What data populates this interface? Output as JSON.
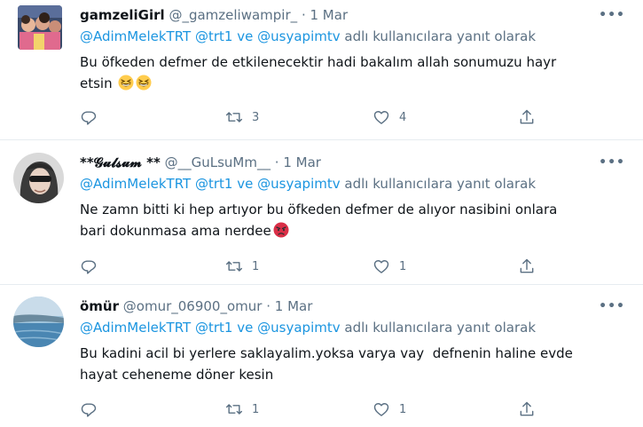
{
  "tweets": [
    {
      "name": "gamzeliGirl",
      "handle": "@_gamzeliwampir_",
      "dot": "·",
      "date": "1 Mar",
      "more": "•••",
      "mentions": [
        "@AdimMelekTRT",
        "@trt1",
        "@usyapimtv"
      ],
      "ve": "ve",
      "reply_suffix": "adlı kullanıcılara yanıt olarak",
      "text_lines": [
        "Bu öfkeden defmer de etkilenecektir hadi bakalım allah sonumuzu hayr",
        "etsin"
      ],
      "emojis": [
        "grinning-squint-emoji",
        "grinning-squint-emoji"
      ],
      "retweets": "3",
      "likes": "4"
    },
    {
      "name": "**𝓖𝓾𝓵𝓼𝓾𝓶 **",
      "handle": "@__GuLsuMm__",
      "dot": "·",
      "date": "1 Mar",
      "more": "•••",
      "mentions": [
        "@AdimMelekTRT",
        "@trt1",
        "@usyapimtv"
      ],
      "ve": "ve",
      "reply_suffix": "adlı kullanıcılara yanıt olarak",
      "text_lines": [
        "Ne zamn bitti ki hep artıyor bu öfkeden defmer de alıyor nasibini onlara",
        "bari dokunmasa ama nerdee"
      ],
      "emojis": [
        "angry-face-emoji"
      ],
      "retweets": "1",
      "likes": "1"
    },
    {
      "name": "ömür",
      "handle": "@omur_06900_omur",
      "dot": "·",
      "date": "1 Mar",
      "more": "•••",
      "mentions": [
        "@AdimMelekTRT",
        "@trt1",
        "@usyapimtv"
      ],
      "ve": "ve",
      "reply_suffix": "adlı kullanıcılara yanıt olarak",
      "text_lines": [
        "Bu kadini acil bi yerlere saklayalim.yoksa varya vay  defnenin haline evde",
        "hayat cehenemе döner kesin"
      ],
      "emojis": [],
      "retweets": "1",
      "likes": "1"
    }
  ],
  "colors": {
    "accent": "#1b95e0",
    "muted": "#5b7083",
    "text": "#0f1419",
    "divider": "#e6ecf0"
  },
  "icons": {
    "reply": "reply-icon",
    "retweet": "retweet-icon",
    "like": "like-icon",
    "share": "share-icon",
    "more": "more-icon"
  }
}
